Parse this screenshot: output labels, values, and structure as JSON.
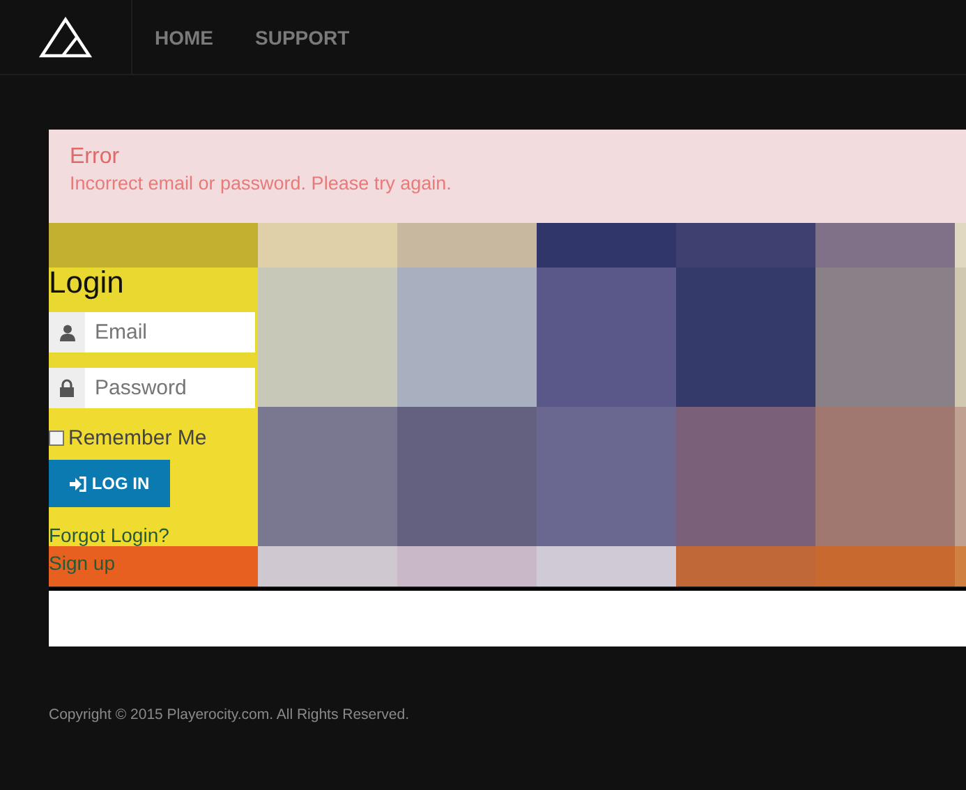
{
  "nav": {
    "items": [
      {
        "label": "HOME"
      },
      {
        "label": "SUPPORT"
      }
    ]
  },
  "alert": {
    "title": "Error",
    "message": "Incorrect email or password. Please try again."
  },
  "login": {
    "title": "Login",
    "email": {
      "placeholder": "Email"
    },
    "password": {
      "placeholder": "Password"
    },
    "remember": {
      "label": "Remember Me",
      "checked": false
    },
    "button": "LOG IN",
    "links": [
      "Forgot Login?",
      "Sign up"
    ]
  },
  "footer": {
    "copyright": "Copyright © 2015 Playerocity.com. All Rights Reserved."
  }
}
